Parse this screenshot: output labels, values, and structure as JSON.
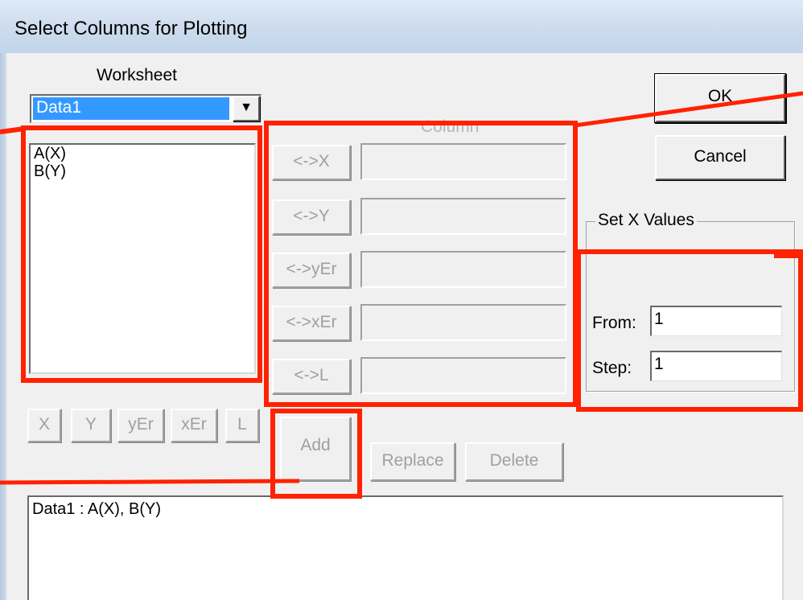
{
  "window": {
    "title": "Select Columns for Plotting"
  },
  "worksheet": {
    "label": "Worksheet",
    "selected": "Data1",
    "dropdown_arrow": "▼",
    "columns": [
      "A(X)",
      "B(Y)"
    ]
  },
  "column_group": {
    "label": "Column",
    "rows": [
      {
        "button": "<->X"
      },
      {
        "button": "<->Y"
      },
      {
        "button": "<->yEr"
      },
      {
        "button": "<->xEr"
      },
      {
        "button": "<->L"
      }
    ]
  },
  "assign_buttons": [
    "X",
    "Y",
    "yEr",
    "xEr",
    "L"
  ],
  "actions": {
    "add": "Add",
    "replace": "Replace",
    "delete": "Delete"
  },
  "dialog_buttons": {
    "ok": "OK",
    "cancel": "Cancel"
  },
  "set_x_values": {
    "title": "Set X Values",
    "from_label": "From:",
    "from_value": "1",
    "step_label": "Step:",
    "step_value": "1"
  },
  "plot_list": {
    "items": [
      "Data1 : A(X), B(Y)"
    ]
  },
  "annotation_color": "#ff2200"
}
